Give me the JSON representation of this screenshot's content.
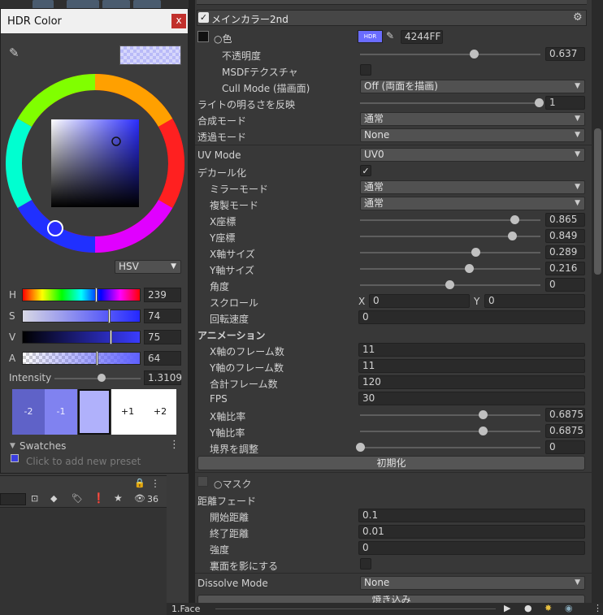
{
  "hdr_window": {
    "title": "HDR Color",
    "close": "x",
    "mode": "HSV",
    "sliders": [
      {
        "label": "H",
        "value": "239",
        "fraction": 0.63
      },
      {
        "label": "S",
        "value": "74",
        "fraction": 0.74
      },
      {
        "label": "V",
        "value": "75",
        "fraction": 0.75
      },
      {
        "label": "A",
        "value": "64",
        "fraction": 0.64
      }
    ],
    "intensity_label": "Intensity",
    "intensity_value": "1.3109",
    "intensity_fraction": 0.55,
    "presets": [
      "-2",
      "-1",
      "",
      "+1",
      "+2"
    ],
    "swatches_label": "Swatches",
    "swatches_hint": "Click to add new preset",
    "accent_color": "#4244FF"
  },
  "project_bar": {
    "count": "36"
  },
  "inspector": {
    "section_title": "メインカラー2nd",
    "color_label": "色",
    "color_hex": "4244FF",
    "hdr_badge": "HDR",
    "rows": [
      {
        "label": "不透明度",
        "type": "slider",
        "value": "0.637",
        "fraction": 0.637
      },
      {
        "label": "MSDFテクスチャ",
        "type": "check",
        "checked": false
      },
      {
        "label": "Cull Mode (描画面)",
        "type": "drop",
        "value": "Off (両面を描画)"
      },
      {
        "label": "ライトの明るさを反映",
        "type": "slider",
        "value": "1",
        "fraction": 1
      },
      {
        "label": "合成モード",
        "type": "drop",
        "value": "通常"
      },
      {
        "label": "透過モード",
        "type": "drop",
        "value": "None"
      },
      {
        "label": "UV Mode",
        "type": "drop",
        "value": "UV0"
      },
      {
        "label": "デカール化",
        "type": "check",
        "checked": true
      },
      {
        "label": "ミラーモード",
        "type": "drop",
        "value": "通常"
      },
      {
        "label": "複製モード",
        "type": "drop",
        "value": "通常"
      },
      {
        "label": "X座標",
        "type": "slider",
        "value": "0.865",
        "fraction": 0.865
      },
      {
        "label": "Y座標",
        "type": "slider",
        "value": "0.849",
        "fraction": 0.849
      },
      {
        "label": "X軸サイズ",
        "type": "slider",
        "value": "0.289",
        "fraction": 0.644
      },
      {
        "label": "Y軸サイズ",
        "type": "slider",
        "value": "0.216",
        "fraction": 0.608
      },
      {
        "label": "角度",
        "type": "slider",
        "value": "0",
        "fraction": 0.5
      },
      {
        "label": "スクロール",
        "type": "xy",
        "x": "0",
        "y": "0",
        "xl": "X",
        "yl": "Y"
      },
      {
        "label": "回転速度",
        "type": "field",
        "value": "0"
      },
      {
        "label": "アニメーション",
        "type": "heading"
      },
      {
        "label": "X軸のフレーム数",
        "type": "field",
        "value": "11"
      },
      {
        "label": "Y軸のフレーム数",
        "type": "field",
        "value": "11"
      },
      {
        "label": "合計フレーム数",
        "type": "field",
        "value": "120"
      },
      {
        "label": "FPS",
        "type": "field",
        "value": "30"
      },
      {
        "label": "X軸比率",
        "type": "slider",
        "value": "0.6875",
        "fraction": 0.688
      },
      {
        "label": "Y軸比率",
        "type": "slider",
        "value": "0.6875",
        "fraction": 0.688
      },
      {
        "label": "境界を調整",
        "type": "slider",
        "value": "0",
        "fraction": 0
      }
    ],
    "reset_button": "初期化",
    "mask_label": "マスク",
    "distance_fade": "距離フェード",
    "fade_rows": [
      {
        "label": "開始距離",
        "value": "0.1"
      },
      {
        "label": "終了距離",
        "value": "0.01"
      },
      {
        "label": "強度",
        "value": "0"
      }
    ],
    "backface_label": "裏面を影にする",
    "dissolve_label": "Dissolve Mode",
    "dissolve_value": "None",
    "bottom_button": "焼き込み",
    "bottom_tab": "1.Face"
  }
}
